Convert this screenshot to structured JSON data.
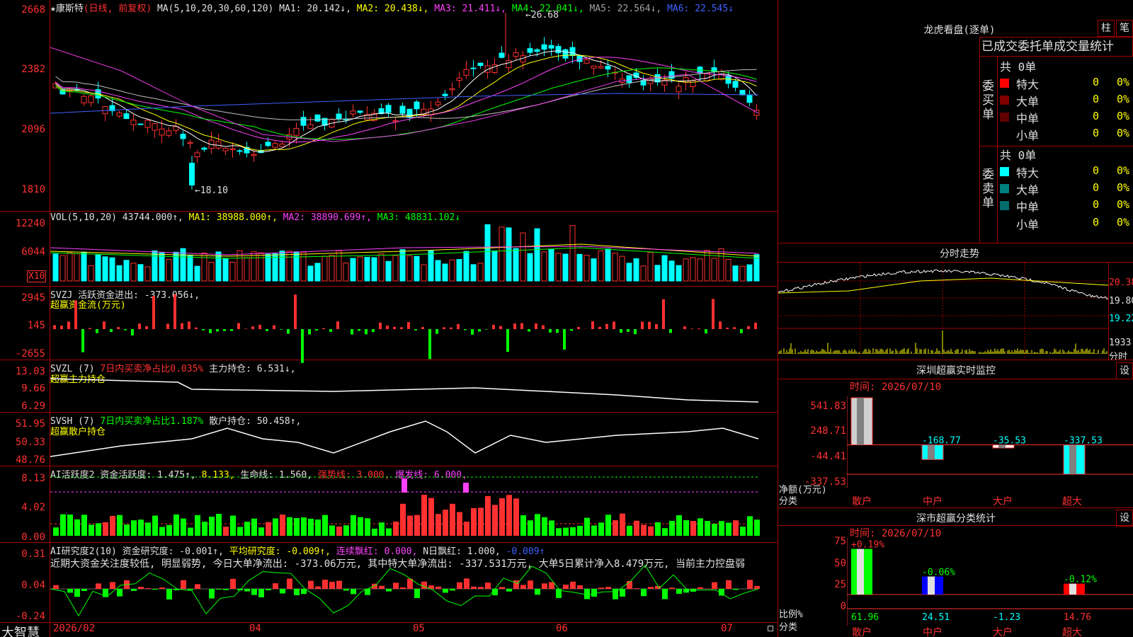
{
  "stock": {
    "star": "★",
    "name": "康斯特",
    "period": "(日线, 前复权)",
    "ma_label": "MA(5,10,20,30,60,120)",
    "ma1": "MA1: 20.142↓,",
    "ma2": "MA2: 20.438↓,",
    "ma3": "MA3: 21.411↓,",
    "ma4": "MA4: 22.041↓,",
    "ma5": "MA5: 22.564↓,",
    "ma6": "MA6: 22.545↓",
    "high_mark": "26.68",
    "low_mark": "18.10",
    "price_axis": [
      "2668",
      "2382",
      "2096",
      "1810"
    ]
  },
  "vol": {
    "label": "VOL(5,10,20)",
    "value": "43744.000↑,",
    "ma1": "MA1: 38988.000↑,",
    "ma2": "MA2: 38890.699↑,",
    "ma3": "MA3: 48831.102↓",
    "axis": [
      "12240",
      "6044"
    ],
    "unit": "X10"
  },
  "svzj": {
    "label": "SVZJ",
    "desc": "活跃资金进出: -373.056↓,",
    "sub": "超赢资金流(万元)",
    "axis": [
      "2945",
      "145",
      "-2655"
    ]
  },
  "svzl": {
    "label": "SVZL (7)",
    "ratio": "7日内买卖净占比0.035%",
    "hold": "主力持仓: 6.531↓,",
    "sub": "超赢主力持仓",
    "axis": [
      "13.03",
      "9.66",
      "6.29"
    ]
  },
  "svsh": {
    "label": "SVSH (7)",
    "ratio": "7日内买卖净占比1.187%",
    "hold": "散户持仓: 50.458↑,",
    "sub": "超赢散户持仓",
    "axis": [
      "51.95",
      "50.33",
      "48.76"
    ]
  },
  "ai_active": {
    "label": "AI活跃度2",
    "v1": "资金活跃度: 1.475↑,",
    "v2": "8.133,",
    "v3": "生命线: 1.560,",
    "v4": "强势线: 3.000,",
    "v5": "爆发线: 6.000,",
    "axis": [
      "8.13",
      "4.02",
      "0.00"
    ]
  },
  "ai_research": {
    "label": "AI研究度2(10)",
    "v1": "资金研究度: -0.001↑,",
    "v2": "平均研究度: -0.009↑,",
    "v3": "连续飘红: 0.000,",
    "v4": "N日飘红: 1.000,",
    "v5": "-0.009↑",
    "comment": "近期大资金关注度较低, 明显弱势, 今日大单净流出: -373.06万元, 其中特大单净流出: -337.531万元, 大单5日累计净入8.479万元, 当前主力控盘弱",
    "axis": [
      "0.31",
      "0.04",
      "-0.24"
    ]
  },
  "footer": {
    "brand": "大智慧",
    "dates": [
      "2026/02",
      "04",
      "05",
      "06",
      "07"
    ]
  },
  "lhb": {
    "title": "龙虎看盘(逐单)",
    "btn1": "柱",
    "btn2": "笔",
    "subtitle": "已成交委托单成交量统计",
    "buy_label": "委买单",
    "sell_label": "委卖单",
    "buy_total": "共 0单",
    "sell_total": "共 0单",
    "rows": [
      "特大",
      "大单",
      "中单",
      "小单"
    ],
    "zero": "0",
    "pct": "0%"
  },
  "intraday": {
    "title": "分时走势",
    "axis": [
      "20.38",
      "19.80",
      "19.22",
      "1933",
      "分时"
    ]
  },
  "sz_monitor": {
    "title": "深圳超赢实时监控",
    "btn": "设",
    "time": "时间: 2026/07/10",
    "axis": [
      "541.83",
      "248.71",
      "-44.41",
      "-337.53"
    ],
    "ylabel1": "净额(万元)",
    "ylabel2": "分类",
    "bars": [
      {
        "cat": "散户",
        "value": 541.83,
        "label": "541.83"
      },
      {
        "cat": "中户",
        "value": -168.77,
        "label": "-168.77"
      },
      {
        "cat": "大户",
        "value": -35.53,
        "label": "-35.53"
      },
      {
        "cat": "超大",
        "value": -337.53,
        "label": "-337.53"
      }
    ]
  },
  "sz_stats": {
    "title": "深市超赢分类统计",
    "btn": "设",
    "time": "时间: 2026/07/10",
    "axis": [
      "75",
      "50",
      "25",
      "0"
    ],
    "ylabel1": "比例%",
    "ylabel2": "分类",
    "bars": [
      {
        "cat": "散户",
        "value": 61.96,
        "label": "61.96",
        "change": "+0.19%"
      },
      {
        "cat": "中户",
        "value": 24.51,
        "label": "24.51",
        "change": "-0.06%"
      },
      {
        "cat": "大户",
        "value": -1.23,
        "label": "-1.23",
        "change": ""
      },
      {
        "cat": "超大",
        "value": 14.76,
        "label": "14.76",
        "change": "-0.12%"
      }
    ]
  },
  "colors": {
    "up": "#ff3030",
    "down": "#00ffff",
    "grid": "#a00000",
    "ma1": "#ffffff",
    "ma2": "#ffff00",
    "ma3": "#ff40ff",
    "ma4": "#00ff00",
    "ma5": "#c0c0c0",
    "ma6": "#4060ff"
  }
}
